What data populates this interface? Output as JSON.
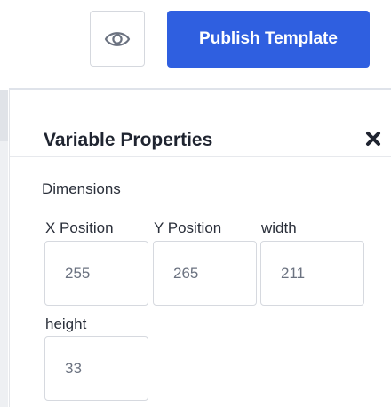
{
  "toolbar": {
    "preview_icon": "eye-icon",
    "publish_label": "Publish Template"
  },
  "colors": {
    "primary": "#2f5fe0",
    "border": "#d6d9df",
    "value_text": "#6b7280"
  },
  "panel": {
    "title": "Variable Properties",
    "close_icon": "close-icon",
    "section_label": "Dimensions",
    "fields": {
      "x": {
        "label": "X Position",
        "value": "255"
      },
      "y": {
        "label": "Y Position",
        "value": "265"
      },
      "width": {
        "label": "width",
        "value": "211"
      },
      "height": {
        "label": "height",
        "value": "33"
      }
    }
  }
}
